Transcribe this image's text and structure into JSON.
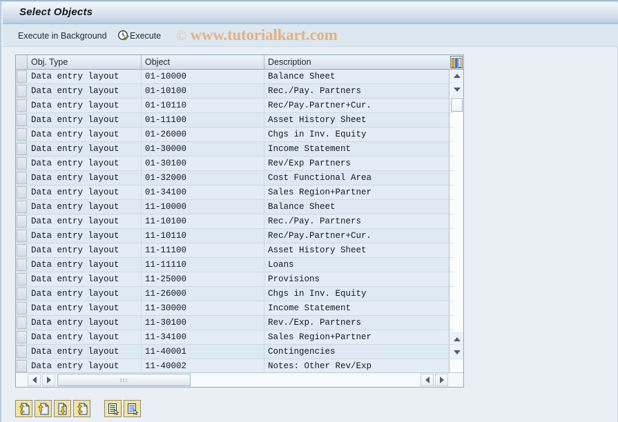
{
  "window": {
    "title": "Select Objects"
  },
  "toolbar": {
    "execute_background_label": "Execute in Background",
    "execute_label": "Execute",
    "execute_icon": "clock-check-icon",
    "watermark_mark": "©",
    "watermark_text": "www.tutorialkart.com",
    "watermark_color": "#e3b183"
  },
  "grid": {
    "columns": [
      "Obj. Type",
      "Object",
      "Description"
    ],
    "column_config_icon": "column-config-icon",
    "rows": [
      {
        "type": "Data entry layout",
        "object": "01-10000",
        "description": "Balance Sheet"
      },
      {
        "type": "Data entry layout",
        "object": "01-10100",
        "description": "Rec./Pay. Partners"
      },
      {
        "type": "Data entry layout",
        "object": "01-10110",
        "description": "Rec/Pay.Partner+Cur."
      },
      {
        "type": "Data entry layout",
        "object": "01-11100",
        "description": "Asset History Sheet"
      },
      {
        "type": "Data entry layout",
        "object": "01-26000",
        "description": "Chgs in Inv. Equity"
      },
      {
        "type": "Data entry layout",
        "object": "01-30000",
        "description": "Income Statement"
      },
      {
        "type": "Data entry layout",
        "object": "01-30100",
        "description": "Rev/Exp Partners"
      },
      {
        "type": "Data entry layout",
        "object": "01-32000",
        "description": "Cost Functional Area"
      },
      {
        "type": "Data entry layout",
        "object": "01-34100",
        "description": "Sales Region+Partner"
      },
      {
        "type": "Data entry layout",
        "object": "11-10000",
        "description": "Balance Sheet"
      },
      {
        "type": "Data entry layout",
        "object": "11-10100",
        "description": "Rec./Pay. Partners"
      },
      {
        "type": "Data entry layout",
        "object": "11-10110",
        "description": "Rec/Pay.Partner+Cur."
      },
      {
        "type": "Data entry layout",
        "object": "11-11100",
        "description": "Asset History Sheet"
      },
      {
        "type": "Data entry layout",
        "object": "11-11110",
        "description": "Loans"
      },
      {
        "type": "Data entry layout",
        "object": "11-25000",
        "description": "Provisions"
      },
      {
        "type": "Data entry layout",
        "object": "11-26000",
        "description": "Chgs in Inv. Equity"
      },
      {
        "type": "Data entry layout",
        "object": "11-30000",
        "description": "Income Statement"
      },
      {
        "type": "Data entry layout",
        "object": "11-30100",
        "description": "Rev./Exp. Partners"
      },
      {
        "type": "Data entry layout",
        "object": "11-34100",
        "description": "Sales Region+Partner"
      },
      {
        "type": "Data entry layout",
        "object": "11-40001",
        "description": "Contingencies"
      },
      {
        "type": "Data entry layout",
        "object": "11-40002",
        "description": "Notes: Other Rev/Exp"
      }
    ]
  },
  "scrollbars": {
    "vertical": {
      "up_icon": "triangle-up-icon",
      "down_icon": "triangle-down-icon",
      "thumb": "vertical-scroll-thumb"
    },
    "horizontal": {
      "left_icon": "triangle-left-icon",
      "right_icon": "triangle-right-icon",
      "thumb": "horizontal-scroll-thumb"
    }
  },
  "bottom_buttons": [
    {
      "icon": "document-import-yellow-icon"
    },
    {
      "icon": "document-upload-yellow-icon"
    },
    {
      "icon": "document-download-yellow-icon"
    },
    {
      "icon": "document-transfer-yellow-icon"
    },
    {
      "icon": "list-select-green-icon"
    },
    {
      "icon": "document-select-blue-icon"
    }
  ]
}
